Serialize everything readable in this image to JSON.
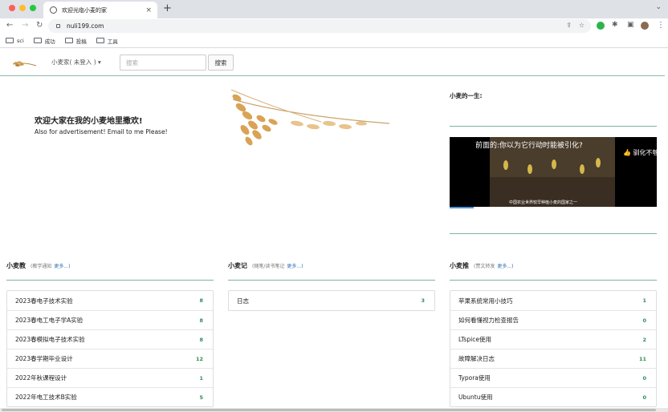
{
  "browser": {
    "tab_title": "欢迎光临小麦的家",
    "tab_close": "×",
    "new_tab": "+",
    "url": "nuli199.com",
    "bookmarks": [
      "sci",
      "成功",
      "投稿",
      "工具"
    ]
  },
  "site": {
    "user_menu": "小麦家( 未登入 ) ▾",
    "search_placeholder": "搜索",
    "search_button": "搜索"
  },
  "hero": {
    "title": "欢迎大家在我的小麦地里撒欢!",
    "subtitle": "Also for advertisement!  Email to me Please!"
  },
  "life": {
    "title": "小麦的一生:",
    "video_caption": "前面的:你以为它行动时能被引化?",
    "video_right": "👍 驯化不够",
    "video_bottom": "中国农业世界较早种植小麦的国家之一"
  },
  "columns": [
    {
      "title": "小麦教",
      "sub": "(教学通知",
      "more": "更多...)",
      "items": [
        {
          "label": "2023春电子技术实验",
          "count": "8"
        },
        {
          "label": "2023春电工电子学A实验",
          "count": "8"
        },
        {
          "label": "2023春模拟电子技术实验",
          "count": "8"
        },
        {
          "label": "2023春学期毕业设计",
          "count": "12"
        },
        {
          "label": "2022年秋课程设计",
          "count": "1"
        },
        {
          "label": "2022年电工技术B实验",
          "count": "5"
        }
      ]
    },
    {
      "title": "小麦记",
      "sub": "(随笔/读书笔记",
      "more": "更多...)",
      "items": [
        {
          "label": "日志",
          "count": "3"
        }
      ]
    },
    {
      "title": "小麦推",
      "sub": "(赞文转发",
      "more": "更多...)",
      "items": [
        {
          "label": "苹果系统常用小技巧",
          "count": "1"
        },
        {
          "label": "如何看懂视力检查报告",
          "count": "0"
        },
        {
          "label": "LTspice使用",
          "count": "2"
        },
        {
          "label": "故障解决日志",
          "count": "11"
        },
        {
          "label": "Typora使用",
          "count": "0"
        },
        {
          "label": "Ubuntu使用",
          "count": "0"
        }
      ]
    }
  ]
}
